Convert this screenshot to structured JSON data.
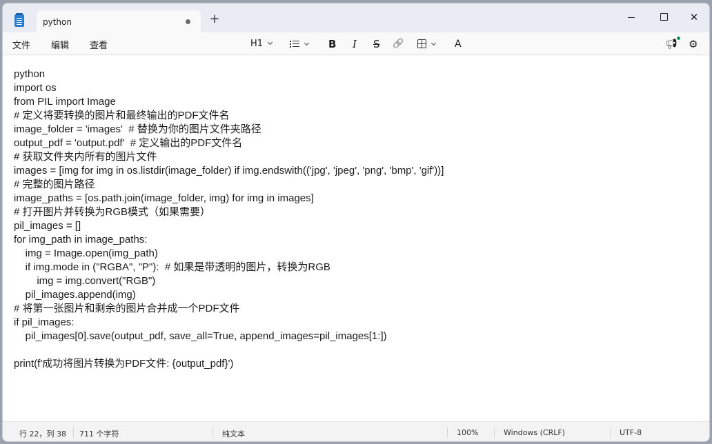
{
  "tab": {
    "title": "python"
  },
  "window": {
    "close_glyph": "✕",
    "new_tab_glyph": "+"
  },
  "menu": {
    "file": "文件",
    "edit": "编辑",
    "view": "查看"
  },
  "toolbar": {
    "heading": "H1",
    "bold": "B",
    "italic": "I",
    "strike": "S",
    "link": "🔗",
    "spell": "A"
  },
  "icons": {
    "app": "notepad-icon",
    "list": "list-icon",
    "table": "table-icon",
    "copilot": "megaphone-icon",
    "settings": "gear-icon"
  },
  "editor": {
    "lines": [
      "python",
      "import os",
      "from PIL import Image",
      "# 定义将要转换的图片和最终输出的PDF文件名",
      "image_folder = 'images'  # 替换为你的图片文件夹路径",
      "output_pdf = 'output.pdf'  # 定义输出的PDF文件名",
      "# 获取文件夹内所有的图片文件",
      "images = [img for img in os.listdir(image_folder) if img.endswith(('jpg', 'jpeg', 'png', 'bmp', 'gif'))]",
      "# 完整的图片路径",
      "image_paths = [os.path.join(image_folder, img) for img in images]",
      "# 打开图片并转换为RGB模式（如果需要）",
      "pil_images = []",
      "for img_path in image_paths:",
      "    img = Image.open(img_path)",
      "    if img.mode in (\"RGBA\", \"P\"):  # 如果是带透明的图片，转换为RGB",
      "        img = img.convert(\"RGB\")",
      "    pil_images.append(img)",
      "# 将第一张图片和剩余的图片合并成一个PDF文件",
      "if pil_images:",
      "    pil_images[0].save(output_pdf, save_all=True, append_images=pil_images[1:])",
      "",
      "print(f'成功将图片转换为PDF文件: {output_pdf}')"
    ]
  },
  "status": {
    "position": "行 22，列 38",
    "chars": "711 个字符",
    "format": "纯文本",
    "zoom": "100%",
    "line_ending": "Windows (CRLF)",
    "encoding": "UTF-8"
  },
  "colors": {
    "accent": "#2b7cd3",
    "notify": "#1a8c5a"
  }
}
